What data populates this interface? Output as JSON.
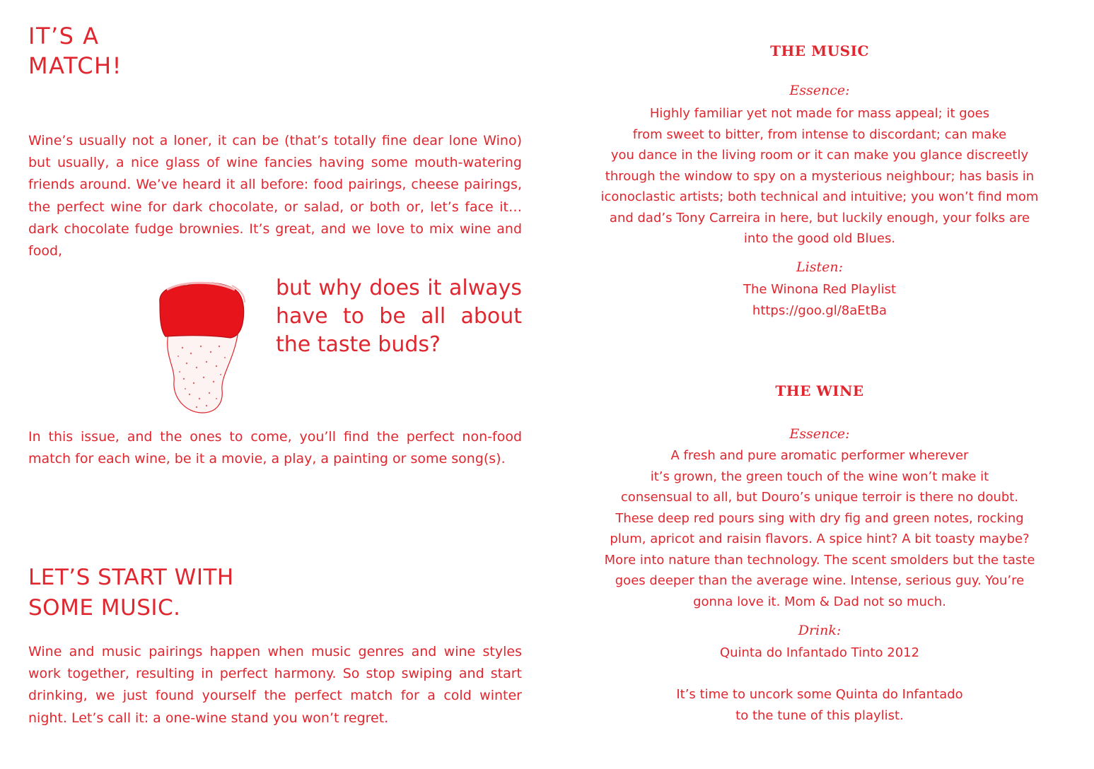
{
  "left": {
    "title_lines": [
      "IT’S A",
      "MATCH!"
    ],
    "intro": "Wine’s usually not a loner, it can be (that’s totally fine dear lone Wino) but usually,  a nice glass of wine fancies having some mouth-watering friends around. We’ve heard it all before: food pairings, cheese pairings, the perfect wine for dark chocolate, or salad, or both or, let’s face it… dark chocolate fudge brownies. It’s great, and we love to mix wine and food,",
    "pullquote": "but why does it always have to be all about the taste buds?",
    "issue": "In this issue, and the ones to come, you’ll find the perfect non-food match for each wine, be it a movie, a play, a painting or some song(s).",
    "section_title_lines": [
      "LET’S START WITH",
      "SOME MUSIC."
    ],
    "pairing": "Wine and music pairings happen when music genres and wine styles work together, resulting in perfect harmony. So stop swiping and start drinking, we just found yourself the perfect match for a cold winter night. Let’s call it: a one-wine stand you won’t regret."
  },
  "music": {
    "heading": "THE MUSIC",
    "essence_label": "Essence:",
    "essence_lines": [
      "Highly familiar yet not made for mass appeal; it goes",
      "from sweet to bitter, from intense to discordant; can make",
      "you dance in the living room or it can make you glance discreetly",
      "through the window to spy on a mysterious neighbour; has basis in",
      "iconoclastic artists; both technical and intuitive; you won’t find mom",
      "and dad’s Tony Carreira in here, but luckily enough, your folks are",
      "into the good old Blues."
    ],
    "listen_label": "Listen:",
    "playlist_name": "The Winona Red Playlist",
    "playlist_url": "https://goo.gl/8aEtBa"
  },
  "wine": {
    "heading": "THE WINE",
    "essence_label": "Essence:",
    "essence_lines": [
      "A fresh and pure aromatic performer wherever",
      "it’s grown, the green touch of the wine won’t make it",
      "consensual to all, but Douro’s unique terroir is there no doubt.",
      "These deep red pours sing with dry fig and green notes, rocking",
      "plum, apricot and raisin flavors. A spice hint? A bit toasty maybe?",
      "More into nature than technology. The scent smolders but the taste",
      "goes deeper than the average wine. Intense, serious guy. You’re",
      "gonna love it. Mom & Dad not so much."
    ],
    "drink_label": "Drink:",
    "wine_name": "Quinta do Infantado Tinto 2012",
    "closing_lines": [
      "It’s time to uncork some Quinta do Infantado",
      "to the tune of this playlist."
    ]
  },
  "colors": {
    "accent": "#e0262e",
    "background": "#ffffff"
  },
  "illustration": {
    "icon": "tongue-icon"
  }
}
